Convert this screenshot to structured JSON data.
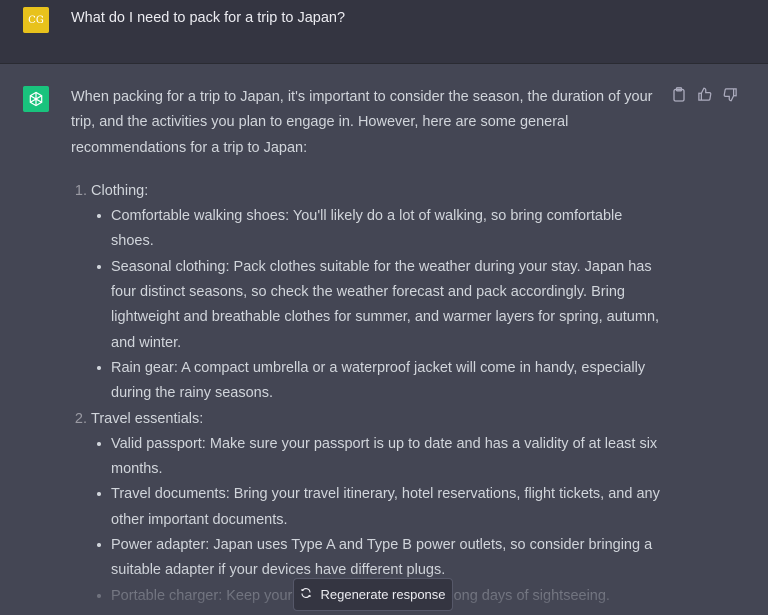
{
  "user": {
    "avatar_initials": "CG",
    "message": "What do I need to pack for a trip to Japan?"
  },
  "assistant": {
    "intro": "When packing for a trip to Japan, it's important to consider the season, the duration of your trip, and the activities you plan to engage in. However, here are some general recommendations for a trip to Japan:",
    "sections": [
      {
        "title": "Clothing:",
        "items": [
          "Comfortable walking shoes: You'll likely do a lot of walking, so bring comfortable shoes.",
          "Seasonal clothing: Pack clothes suitable for the weather during your stay. Japan has four distinct seasons, so check the weather forecast and pack accordingly. Bring lightweight and breathable clothes for summer, and warmer layers for spring, autumn, and winter.",
          "Rain gear: A compact umbrella or a waterproof jacket will come in handy, especially during the rainy seasons."
        ]
      },
      {
        "title": "Travel essentials:",
        "items": [
          "Valid passport: Make sure your passport is up to date and has a validity of at least six months.",
          "Travel documents: Bring your travel itinerary, hotel reservations, flight tickets, and any other important documents.",
          "Power adapter: Japan uses Type A and Type B power outlets, so consider bringing a suitable adapter if your devices have different plugs.",
          "Portable charger: Keep your devices charged during long days of sightseeing."
        ]
      }
    ]
  },
  "actions": {
    "icons": [
      "clipboard-icon",
      "thumbs-up-icon",
      "thumbs-down-icon"
    ]
  },
  "regenerate": {
    "label": "Regenerate response"
  },
  "colors": {
    "user_bg": "#343541",
    "assistant_bg": "#444654",
    "user_avatar": "#e8c21c",
    "gpt_avatar": "#19c37d"
  }
}
